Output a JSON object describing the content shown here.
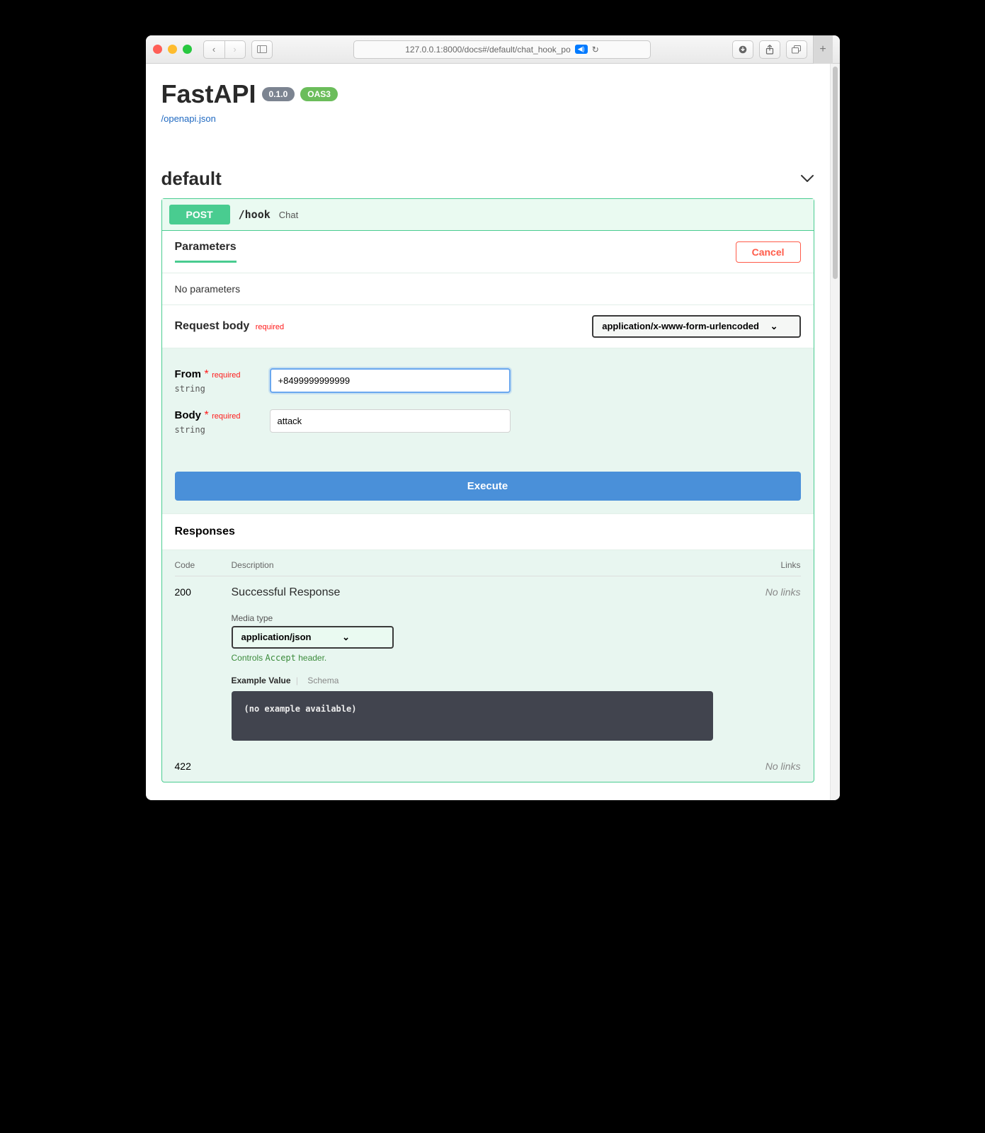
{
  "browser": {
    "url": "127.0.0.1:8000/docs#/default/chat_hook_po",
    "sound_badge": "◀︎)"
  },
  "page": {
    "title": "FastAPI",
    "version_badge": "0.1.0",
    "oas_badge": "OAS3",
    "spec_link": "/openapi.json"
  },
  "section": {
    "name": "default"
  },
  "op": {
    "method": "POST",
    "path": "/hook",
    "summary": "Chat",
    "param_tab": "Parameters",
    "cancel": "Cancel",
    "no_params": "No parameters",
    "request_body_label": "Request body",
    "required_text": "required",
    "content_type": "application/x-www-form-urlencoded",
    "fields": {
      "from": {
        "label": "From",
        "type": "string",
        "value": "+8499999999999"
      },
      "body": {
        "label": "Body",
        "type": "string",
        "value": "attack"
      }
    },
    "execute": "Execute"
  },
  "responses": {
    "heading": "Responses",
    "cols": {
      "code": "Code",
      "desc": "Description",
      "links": "Links"
    },
    "rows": [
      {
        "code": "200",
        "desc": "Successful Response",
        "links": "No links",
        "media_type_label": "Media type",
        "media_type": "application/json",
        "accept_hint_pre": "Controls ",
        "accept_hint_code": "Accept",
        "accept_hint_post": " header.",
        "example_tab": "Example Value",
        "schema_tab": "Schema",
        "example_body": "(no example available)"
      },
      {
        "code": "422",
        "links": "No links"
      }
    ]
  }
}
